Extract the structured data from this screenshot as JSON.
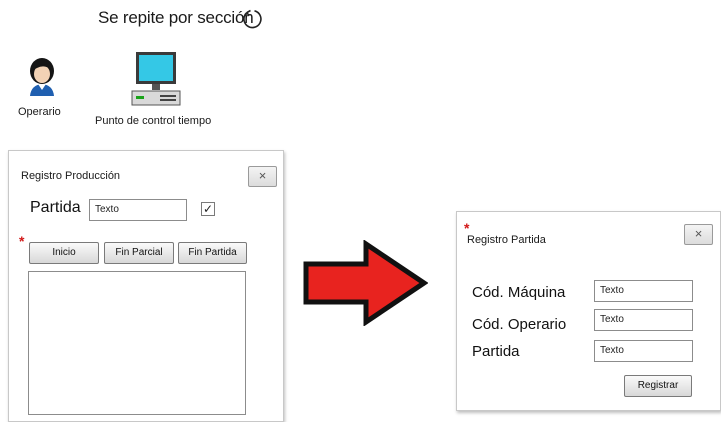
{
  "header": {
    "repeat_text": "Se repite por sección",
    "repeat_icon": "refresh-icon"
  },
  "actors": {
    "operator": {
      "label": "Operario",
      "icon": "person-icon"
    },
    "computer": {
      "label": "Punto de control tiempo",
      "icon": "computer-icon"
    }
  },
  "production_dialog": {
    "title": "Registro Producción",
    "close_label": "×",
    "partida_label": "Partida",
    "partida_value": "Texto",
    "checkbox_mark": "✓",
    "required_mark": "*",
    "buttons": {
      "inicio": "Inicio",
      "fin_parcial": "Fin Parcial",
      "fin_partida": "Fin Partida"
    }
  },
  "partida_dialog": {
    "required_mark": "*",
    "title": "Registro Partida",
    "close_label": "×",
    "fields": {
      "maquina_label": "Cód. Máquina",
      "maquina_value": "Texto",
      "operario_label": "Cód. Operario",
      "operario_value": "Texto",
      "partida_label": "Partida",
      "partida_value": "Texto"
    },
    "submit_label": "Registrar"
  },
  "colors": {
    "arrow_fill": "#e8231f",
    "arrow_stroke": "#111111",
    "monitor_screen": "#34c8e6",
    "required": "#d21818"
  }
}
